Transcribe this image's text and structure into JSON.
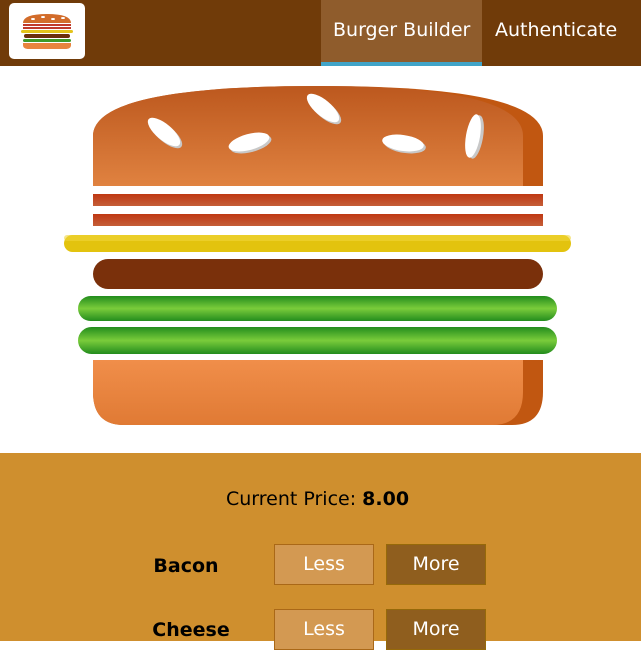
{
  "app": {
    "logo_icon": "burger-logo-icon"
  },
  "nav": {
    "items": [
      {
        "label": "Burger Builder",
        "active": true
      },
      {
        "label": "Authenticate",
        "active": false
      }
    ]
  },
  "build_controls": {
    "price_label": "Current Price:",
    "price_value": "8.00",
    "controls": [
      {
        "label": "Bacon",
        "less_label": "Less",
        "more_label": "More"
      },
      {
        "label": "Cheese",
        "less_label": "Less",
        "more_label": "More"
      }
    ]
  },
  "colors": {
    "toolbar": "#703B09",
    "nav_active_bg": "#8F5C2C",
    "nav_active_border": "#40A4C8",
    "controls_bg": "#CF8F2E",
    "less_button": "#D39952",
    "more_button": "#8F5E1E"
  }
}
